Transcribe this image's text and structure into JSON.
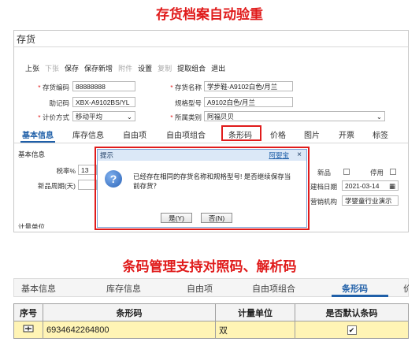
{
  "heading_top": "存货档案自动验重",
  "window_title": "存货",
  "toolbar": [
    "上张",
    "下张",
    "保存",
    "保存新增",
    "附件",
    "设置",
    "复制",
    "提取组合",
    "退出"
  ],
  "toolbar_disabled": [
    "下张",
    "附件",
    "复制"
  ],
  "form": {
    "code_label": "存货编码",
    "code_value": "88888888",
    "name_label": "存货名称",
    "name_value": "学步鞋-A9102白色/月兰",
    "mnemonic_label": "助记码",
    "mnemonic_value": "XBX-A9102BS/YL",
    "spec_label": "规格型号",
    "spec_value": "A9102白色/月兰",
    "valuation_label": "计价方式",
    "valuation_value": "移动平均",
    "category_label": "所属类别",
    "category_value": "阿福贝贝"
  },
  "tabs_top": [
    "基本信息",
    "库存信息",
    "自由项",
    "自由项组合",
    "条形码",
    "价格",
    "图片",
    "开票",
    "标签"
  ],
  "section_basic": "基本信息",
  "bg_fields": {
    "tax_label": "税率%",
    "tax_value": "13",
    "newcycle_label": "新品周期(天)",
    "newitem_label": "新品",
    "disabled_label": "停用",
    "date_label": "建档日期",
    "date_value": "2021-03-14",
    "org_label": "营销机构",
    "org_value": "学婴童行业演示"
  },
  "section_measure": "计量单位",
  "dialog": {
    "title": "提示",
    "user_link": "阿婴宝",
    "close": "×",
    "message": "已经存在相同的存货名称和规格型号! 是否继续保存当前存货？",
    "yes_label": "是(Y)",
    "no_label": "否(N)"
  },
  "heading_bottom": "条码管理支持对照码、解析码",
  "tabs_bottom": [
    "基本信息",
    "库存信息",
    "自由项",
    "自由项组合",
    "条形码",
    "价"
  ],
  "table": {
    "headers": [
      "序号",
      "条形码",
      "计量单位",
      "是否默认条码"
    ],
    "rows": [
      {
        "index_icon": "row-marker-icon",
        "barcode": "6934642264800",
        "unit": "双",
        "default": true
      }
    ]
  },
  "colors": {
    "accent_red": "#e01b1b",
    "tab_blue": "#1f5fa8",
    "row_highlight": "#fff4b5"
  }
}
